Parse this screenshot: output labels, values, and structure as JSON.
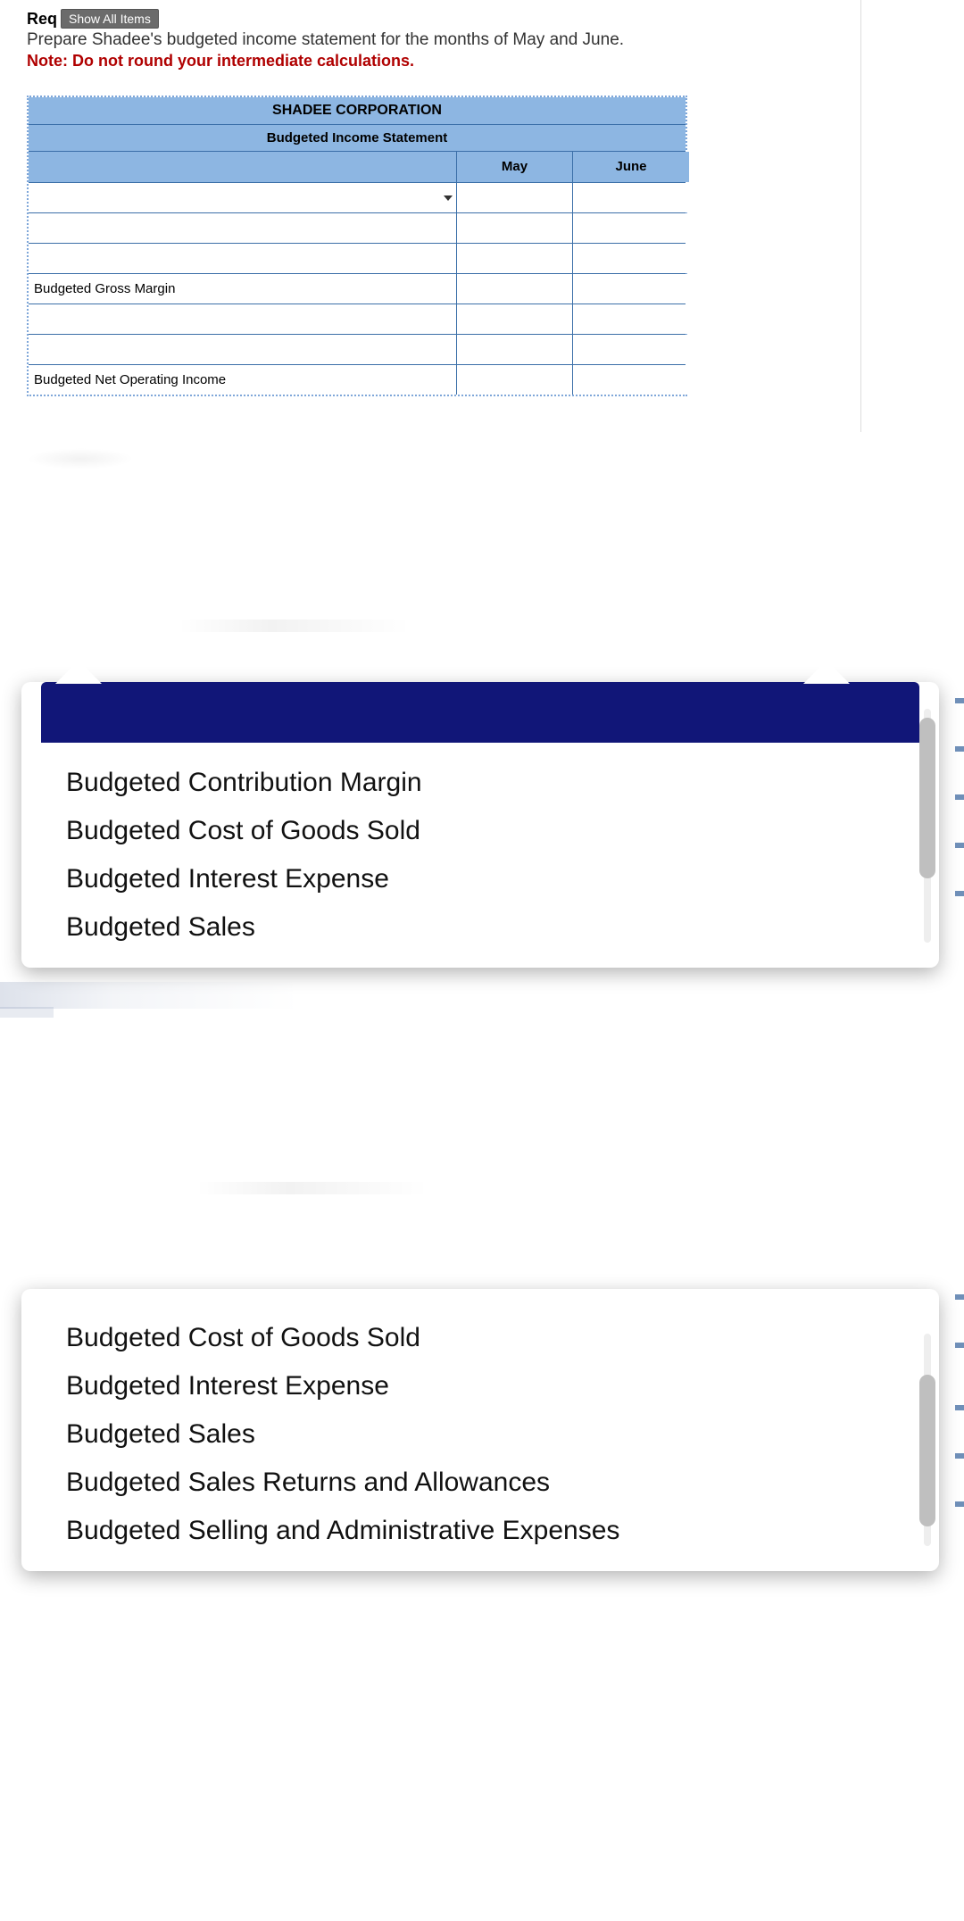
{
  "header": {
    "req_label": "Req",
    "show_all_btn": "Show All Items",
    "instruction": "Prepare Shadee's budgeted income statement for the months of May and June.",
    "note": "Note: Do not round your intermediate calculations."
  },
  "table": {
    "title1": "SHADEE CORPORATION",
    "title2": "Budgeted Income Statement",
    "col_may": "May",
    "col_june": "June",
    "rows": [
      {
        "label": "",
        "may": "",
        "june": "",
        "dropdown": true
      },
      {
        "label": "",
        "may": "",
        "june": ""
      },
      {
        "label": "",
        "may": "",
        "june": ""
      },
      {
        "label": "Budgeted Gross Margin",
        "may": "",
        "june": ""
      },
      {
        "label": "",
        "may": "",
        "june": ""
      },
      {
        "label": "",
        "may": "",
        "june": ""
      },
      {
        "label": "Budgeted Net Operating Income",
        "may": "",
        "june": ""
      }
    ]
  },
  "dropdown1": {
    "options": [
      "Budgeted Contribution Margin",
      "Budgeted Cost of Goods Sold",
      "Budgeted Interest Expense",
      "Budgeted Sales"
    ]
  },
  "dropdown2": {
    "options": [
      "Budgeted Cost of Goods Sold",
      "Budgeted Interest Expense",
      "Budgeted Sales",
      "Budgeted Sales Returns and Allowances",
      "Budgeted Selling and Administrative Expenses"
    ]
  }
}
